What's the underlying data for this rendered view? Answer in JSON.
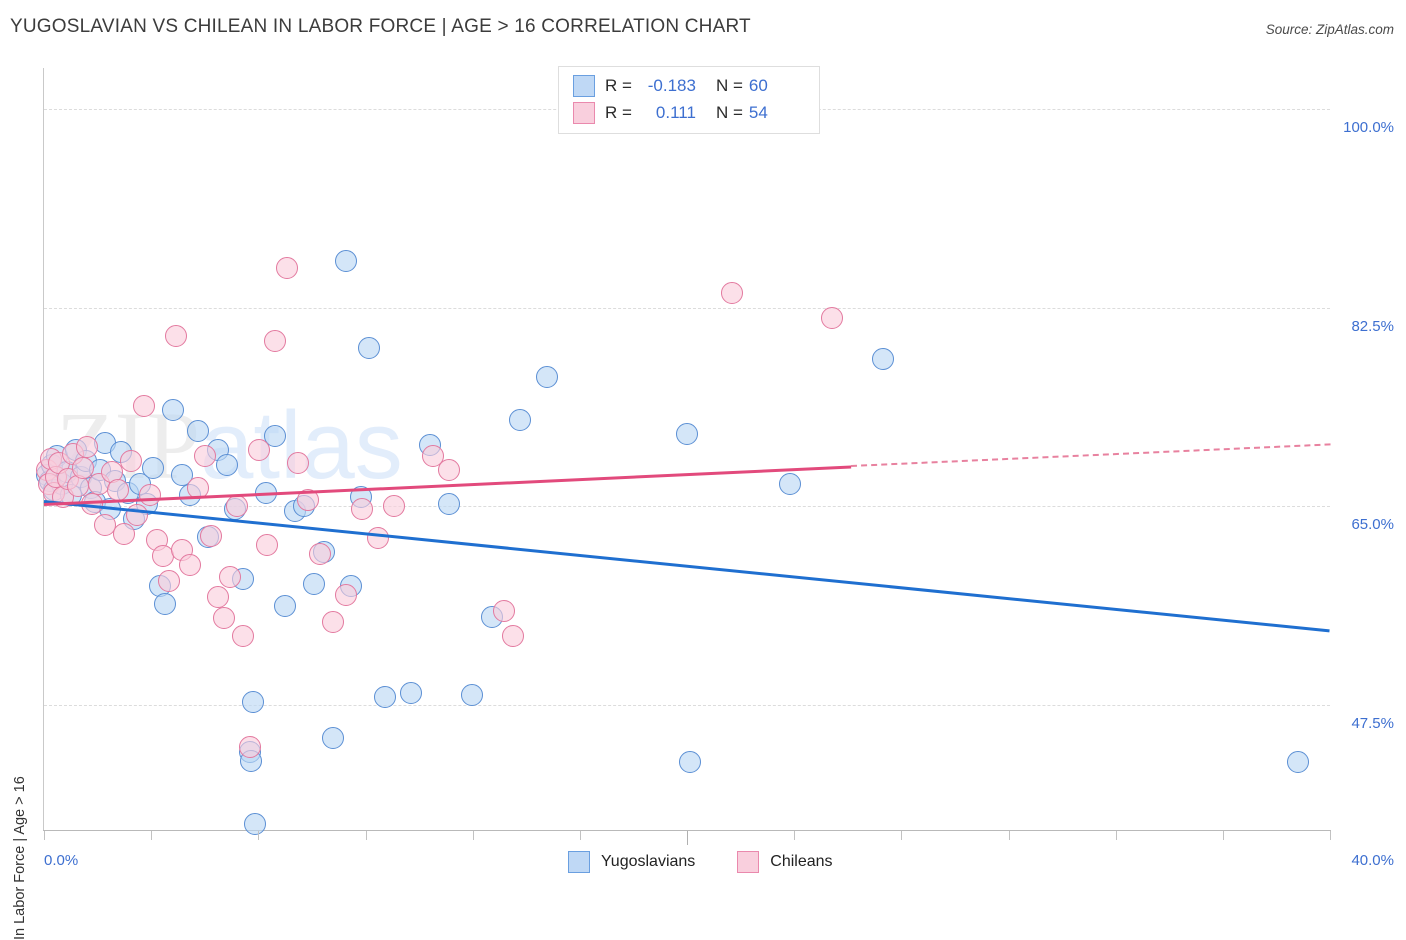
{
  "header": {
    "title": "YUGOSLAVIAN VS CHILEAN IN LABOR FORCE | AGE > 16 CORRELATION CHART",
    "source": "Source: ZipAtlas.com"
  },
  "watermark": {
    "part1": "ZIP",
    "part2": "atlas"
  },
  "legend_stats": {
    "rows": [
      {
        "r_label": "R =",
        "r_value": "-0.183",
        "n_label": "N =",
        "n_value": "60",
        "color": "#bfd8f5"
      },
      {
        "r_label": "R =",
        "r_value": "0.111",
        "n_label": "N =",
        "n_value": "54",
        "color": "#f9cfdd"
      }
    ]
  },
  "series_legend": [
    {
      "label": "Yugoslavians",
      "color": "#bfd8f5"
    },
    {
      "label": "Chileans",
      "color": "#f9cfdd"
    }
  ],
  "axes": {
    "y_title": "In Labor Force | Age > 16",
    "y_ticks": [
      "100.0%",
      "82.5%",
      "65.0%",
      "47.5%"
    ],
    "x_min_label": "0.0%",
    "x_max_label": "40.0%"
  },
  "chart_data": {
    "type": "scatter",
    "title": "YUGOSLAVIAN VS CHILEAN IN LABOR FORCE | AGE > 16 CORRELATION CHART",
    "xlabel": "",
    "ylabel": "In Labor Force | Age > 16",
    "xlim": [
      0.0,
      40.0
    ],
    "ylim": [
      36.5,
      103.6
    ],
    "y_ticks": [
      100.0,
      82.5,
      65.0,
      47.5
    ],
    "x_ticks": [
      0.0,
      40.0
    ],
    "grid": true,
    "legend_position": "bottom-center",
    "series": [
      {
        "name": "Yugoslavians",
        "color": "#bfd8f5",
        "border": "#5b8fd4",
        "R": -0.183,
        "N": 60,
        "trendline": {
          "x0": 0.0,
          "y0": 65.6,
          "x1": 40.0,
          "y1": 54.2,
          "style": "solid"
        },
        "points": [
          [
            0.1,
            67.8
          ],
          [
            0.18,
            67.2
          ],
          [
            0.25,
            68.6
          ],
          [
            0.32,
            66.4
          ],
          [
            0.4,
            69.4
          ],
          [
            0.55,
            67.0
          ],
          [
            0.7,
            68.0
          ],
          [
            0.85,
            66.0
          ],
          [
            1.0,
            70.0
          ],
          [
            1.15,
            67.6
          ],
          [
            1.3,
            69.0
          ],
          [
            1.45,
            66.6
          ],
          [
            1.6,
            65.4
          ],
          [
            1.75,
            68.2
          ],
          [
            1.9,
            70.6
          ],
          [
            2.05,
            64.8
          ],
          [
            2.2,
            67.2
          ],
          [
            2.4,
            69.8
          ],
          [
            2.6,
            66.2
          ],
          [
            2.8,
            63.9
          ],
          [
            3.0,
            67.0
          ],
          [
            3.2,
            65.2
          ],
          [
            3.4,
            68.4
          ],
          [
            3.6,
            58.0
          ],
          [
            3.75,
            56.4
          ],
          [
            4.0,
            73.5
          ],
          [
            4.3,
            67.8
          ],
          [
            4.55,
            66.0
          ],
          [
            4.8,
            71.6
          ],
          [
            5.1,
            62.3
          ],
          [
            5.4,
            70.0
          ],
          [
            5.7,
            68.6
          ],
          [
            5.95,
            64.8
          ],
          [
            6.2,
            58.6
          ],
          [
            6.4,
            43.4
          ],
          [
            6.45,
            42.6
          ],
          [
            6.5,
            47.8
          ],
          [
            6.55,
            37.0
          ],
          [
            6.9,
            66.2
          ],
          [
            7.2,
            71.2
          ],
          [
            7.5,
            56.2
          ],
          [
            7.8,
            64.6
          ],
          [
            8.1,
            65.0
          ],
          [
            8.4,
            58.2
          ],
          [
            8.7,
            61.0
          ],
          [
            9.0,
            44.6
          ],
          [
            9.4,
            86.6
          ],
          [
            9.55,
            58.0
          ],
          [
            9.85,
            65.8
          ],
          [
            10.1,
            78.9
          ],
          [
            10.6,
            48.2
          ],
          [
            11.4,
            48.6
          ],
          [
            12.0,
            70.4
          ],
          [
            12.6,
            65.2
          ],
          [
            13.3,
            48.4
          ],
          [
            13.95,
            55.3
          ],
          [
            14.8,
            72.6
          ],
          [
            15.65,
            76.4
          ],
          [
            20.0,
            71.4
          ],
          [
            20.1,
            42.5
          ],
          [
            23.2,
            67.0
          ],
          [
            26.1,
            78.0
          ],
          [
            39.0,
            42.5
          ]
        ]
      },
      {
        "name": "Chileans",
        "color": "#f9cfdd",
        "border": "#e3799f",
        "R": 0.111,
        "N": 54,
        "trendline": {
          "x0": 0.0,
          "y0": 65.3,
          "x1": 25.1,
          "y1": 68.6,
          "style": "solid"
        },
        "trendline_extension": {
          "x0": 25.1,
          "y0": 68.6,
          "x1": 40.0,
          "y1": 70.5,
          "style": "dashed"
        },
        "points": [
          [
            0.08,
            68.2
          ],
          [
            0.15,
            67.0
          ],
          [
            0.22,
            69.2
          ],
          [
            0.3,
            66.2
          ],
          [
            0.38,
            67.6
          ],
          [
            0.48,
            68.8
          ],
          [
            0.6,
            65.8
          ],
          [
            0.75,
            67.4
          ],
          [
            0.9,
            69.6
          ],
          [
            1.05,
            66.8
          ],
          [
            1.2,
            68.4
          ],
          [
            1.35,
            70.2
          ],
          [
            1.5,
            65.2
          ],
          [
            1.7,
            67.0
          ],
          [
            1.9,
            63.4
          ],
          [
            2.1,
            68.0
          ],
          [
            2.3,
            66.4
          ],
          [
            2.5,
            62.6
          ],
          [
            2.7,
            69.0
          ],
          [
            2.9,
            64.2
          ],
          [
            3.1,
            73.8
          ],
          [
            3.3,
            66.0
          ],
          [
            3.5,
            62.0
          ],
          [
            3.7,
            60.6
          ],
          [
            3.9,
            58.4
          ],
          [
            4.1,
            80.0
          ],
          [
            4.3,
            61.2
          ],
          [
            4.55,
            59.8
          ],
          [
            4.8,
            66.6
          ],
          [
            5.0,
            69.4
          ],
          [
            5.2,
            62.4
          ],
          [
            5.4,
            57.0
          ],
          [
            5.6,
            55.2
          ],
          [
            5.8,
            58.8
          ],
          [
            6.0,
            65.0
          ],
          [
            6.2,
            53.6
          ],
          [
            6.4,
            43.8
          ],
          [
            6.7,
            70.0
          ],
          [
            6.95,
            61.6
          ],
          [
            7.2,
            79.6
          ],
          [
            7.55,
            86.0
          ],
          [
            7.9,
            68.8
          ],
          [
            8.2,
            65.6
          ],
          [
            8.6,
            60.8
          ],
          [
            9.0,
            54.8
          ],
          [
            9.4,
            57.2
          ],
          [
            9.9,
            64.8
          ],
          [
            10.4,
            62.2
          ],
          [
            10.9,
            65.0
          ],
          [
            12.1,
            69.4
          ],
          [
            12.6,
            68.2
          ],
          [
            14.3,
            55.8
          ],
          [
            14.6,
            53.6
          ],
          [
            21.4,
            83.8
          ],
          [
            24.5,
            81.6
          ]
        ]
      }
    ]
  }
}
